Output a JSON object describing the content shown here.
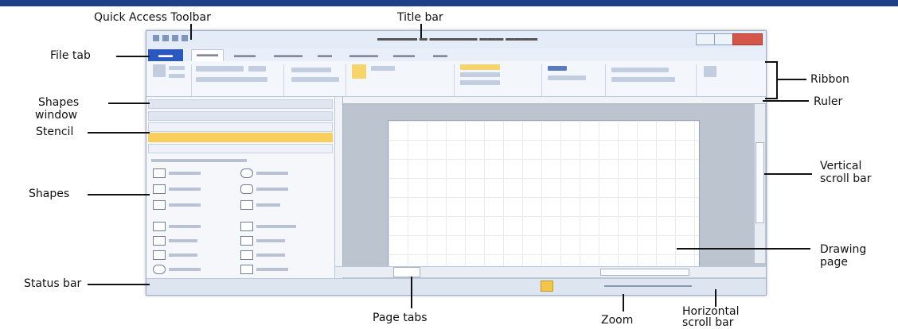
{
  "annotations": {
    "quick_access_toolbar": "Quick Access Toolbar",
    "title_bar": "Title bar",
    "file_tab": "File tab",
    "ribbon": "Ribbon",
    "shapes_window": [
      "Shapes",
      "window"
    ],
    "ruler": "Ruler",
    "stencil": "Stencil",
    "vertical_scroll_bar": [
      "Vertical",
      "scroll bar"
    ],
    "shapes": "Shapes",
    "drawing_page": [
      "Drawing",
      "page"
    ],
    "status_bar": "Status bar",
    "page_tabs": "Page tabs",
    "zoom": "Zoom",
    "horizontal_scroll_bar": [
      "Horizontal",
      "scroll bar"
    ]
  },
  "colors": {
    "top_band": "#1f3f86",
    "file_tab": "#2a58c0",
    "stencil_highlight": "#f7cf5a"
  }
}
